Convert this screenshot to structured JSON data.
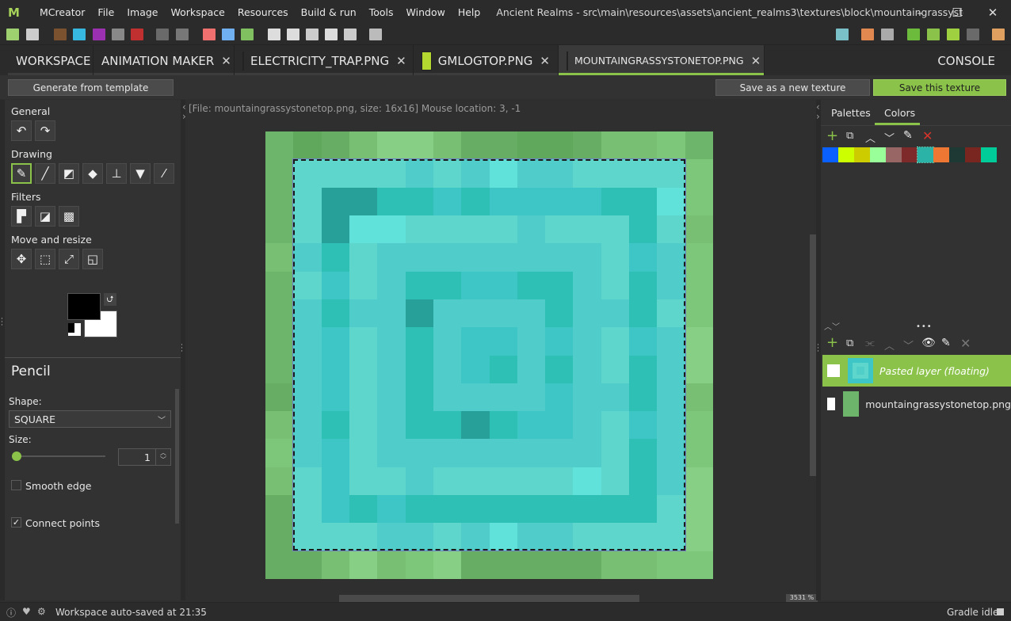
{
  "window": {
    "app_name": "MCreator",
    "title": "Ancient Realms - src\\main\\resources\\assets\\ancient_realms3\\textures\\block\\mountaingrassystonetop.png - ...",
    "controls": {
      "minimize": "–",
      "maximize": "☐",
      "close": "✕"
    }
  },
  "menu": [
    "MCreator",
    "File",
    "Image",
    "Workspace",
    "Resources",
    "Build & run",
    "Tools",
    "Window",
    "Help"
  ],
  "toolbar": {
    "left_icons": [
      "new-texture",
      "new-animation",
      "import-block-texture",
      "import-item-texture",
      "import-entity-texture",
      "import-armor-texture",
      "import-particle-texture",
      "import-painting-texture",
      "import-screen-texture",
      "import-model-red",
      "import-model-blue",
      "import-model-green",
      "new-element-1",
      "new-element-2",
      "new-tool",
      "new-armor",
      "new-block",
      "structure-import"
    ],
    "right_icons": [
      "open-workspace-folder",
      "gradle-build",
      "hammer-build",
      "run-client",
      "debug-client",
      "run-server",
      "stop",
      "export"
    ]
  },
  "tabs": [
    {
      "label": "WORKSPACE",
      "closable": false,
      "active": false
    },
    {
      "label": "ANIMATION MAKER",
      "closable": true,
      "active": false
    },
    {
      "label": "ELECTRICITY_TRAP.PNG",
      "closable": true,
      "active": false,
      "thumb": "#3a9bb0"
    },
    {
      "label": "GMLOGTOP.PNG",
      "closable": true,
      "active": false,
      "thumb": "#b4d830"
    },
    {
      "label": "MOUNTAINGRASSYSTONETOP.PNG",
      "closable": true,
      "active": true,
      "thumb": "#4fcfc8"
    },
    {
      "label": "CONSOLE",
      "closable": false,
      "active": false
    }
  ],
  "actions": {
    "generate": "Generate from template",
    "save_new": "Save as a new texture",
    "save": "Save this texture"
  },
  "tools": {
    "general_label": "General",
    "drawing_label": "Drawing",
    "filters_label": "Filters",
    "move_label": "Move and resize",
    "general": [
      "undo",
      "redo"
    ],
    "drawing": [
      "pencil",
      "line",
      "shape",
      "eraser",
      "stamp",
      "fill",
      "color-picker"
    ],
    "filters": [
      "paint-roller",
      "hue-saturation",
      "noise"
    ],
    "move": [
      "move",
      "selection",
      "resize",
      "copy-transform"
    ],
    "selected": "pencil",
    "primary_color": "#000000",
    "secondary_color": "#ffffff"
  },
  "tool_options": {
    "title": "Pencil",
    "shape_label": "Shape:",
    "shape_value": "SQUARE",
    "size_label": "Size:",
    "size_value": "1",
    "size_slider_fraction": 0.0,
    "smooth_edge_label": "Smooth edge",
    "smooth_edge_checked": false,
    "connect_points_label": "Connect points",
    "connect_points_checked": true
  },
  "canvas": {
    "info": "[File: mountaingrassystonetop.png, size: 16x16] Mouse location: 3, -1",
    "zoom": "3531 %",
    "palette_key": {
      "A": "#5ed6cb",
      "B": "#50cdca",
      "C": "#3ec5c6",
      "D": "#2ec0b4",
      "E": "#26a099",
      "F": "#60e2da",
      "g": "#6db56a",
      "h": "#67ad63",
      "i": "#78bf74",
      "j": "#86cf85",
      "k": "#5fa85c",
      "l": "#7cc77a"
    },
    "pixels": [
      "gkhijjihhkkhiilg",
      "gAAAABABFBBAAAAl",
      "gAEEDDCDCCCCDDFl",
      "gAEFFAAAABAAADAi",
      "iBDABBBBBBBBACBl",
      "gACABDDCCDDBADBl",
      "gBDBBEBBBBDBBDAl",
      "gBCABDBCCBCBACBj",
      "gBCABDBCDBDBADBj",
      "hBCABDBBBBCBBDBi",
      "iBDABDDEDCCBACBl",
      "lBCABBBBBBBBADBl",
      "iACAABAAAAAFADBj",
      "hACDCDDDDDDDDDAj",
      "hAAABBABFBBAAAAj",
      "hhijiljhhhhhiill"
    ]
  },
  "right_panel": {
    "tabs": [
      "Palettes",
      "Colors"
    ],
    "active_tab": "Colors",
    "color_tools": [
      "add",
      "duplicate",
      "move-up",
      "move-down",
      "edit",
      "delete"
    ],
    "swatches": [
      "#0a5fff",
      "#ccff00",
      "#cccc00",
      "#99ff99",
      "#996666",
      "#7f2a2a",
      "#2ab3a6",
      "#ee7733",
      "#1e3833",
      "#7a2620",
      "#00cc99"
    ],
    "layer_tools": [
      "add",
      "duplicate",
      "merge-down",
      "move-up",
      "move-down",
      "visibility",
      "rename",
      "delete"
    ],
    "layers": [
      {
        "name": "Pasted layer (floating)",
        "selected": true,
        "thumb": "#4fcfc8"
      },
      {
        "name": "mountaingrassystonetop.png",
        "selected": false,
        "thumb": "#6db56a"
      }
    ]
  },
  "status": {
    "message": "Workspace auto-saved at 21:35",
    "gradle": "Gradle idle"
  }
}
